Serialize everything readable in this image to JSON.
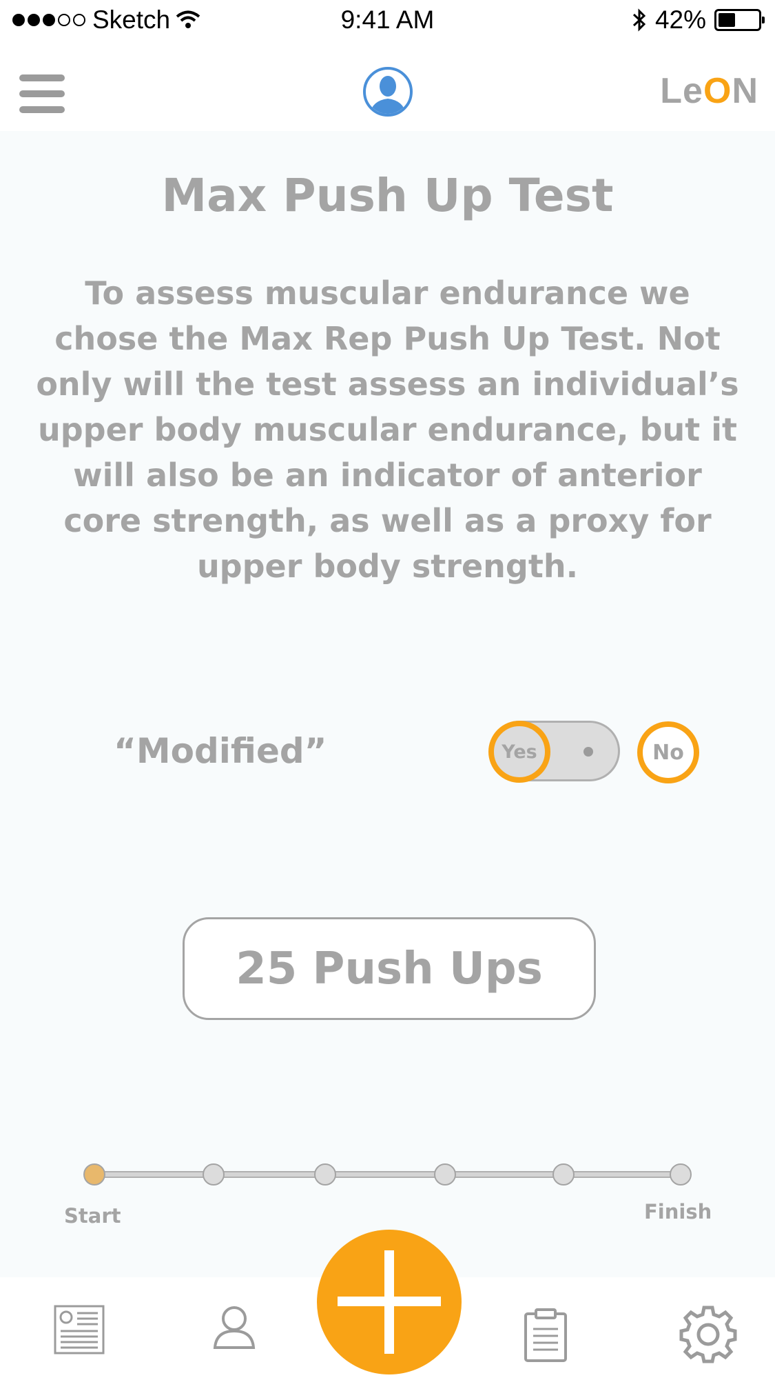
{
  "status_bar": {
    "carrier": "Sketch",
    "time": "9:41 AM",
    "battery": "42%",
    "battery_level": 0.42
  },
  "nav": {
    "logo_prefix": "Le",
    "logo_accent": "O",
    "logo_suffix": "N",
    "accent_color": "#f9a315"
  },
  "test": {
    "title": "Max Push Up Test",
    "description": "To assess muscular endurance we chose the Max Rep Push Up Test. Not only will the test assess an individual’s upper body muscular endurance, but it will also be an indicator of anterior core strength, as well as a proxy for upper body strength.",
    "modified_label": "“Modified”",
    "yes_label": "Yes",
    "no_label": "No",
    "result": "25 Push Ups"
  },
  "progress": {
    "start_label": "Start",
    "finish_label": "Finish",
    "steps": 6,
    "current_step": 1
  },
  "tab_bar": {
    "items": [
      "report-icon",
      "profile-icon",
      "add-icon",
      "clipboard-icon",
      "settings-icon"
    ]
  }
}
